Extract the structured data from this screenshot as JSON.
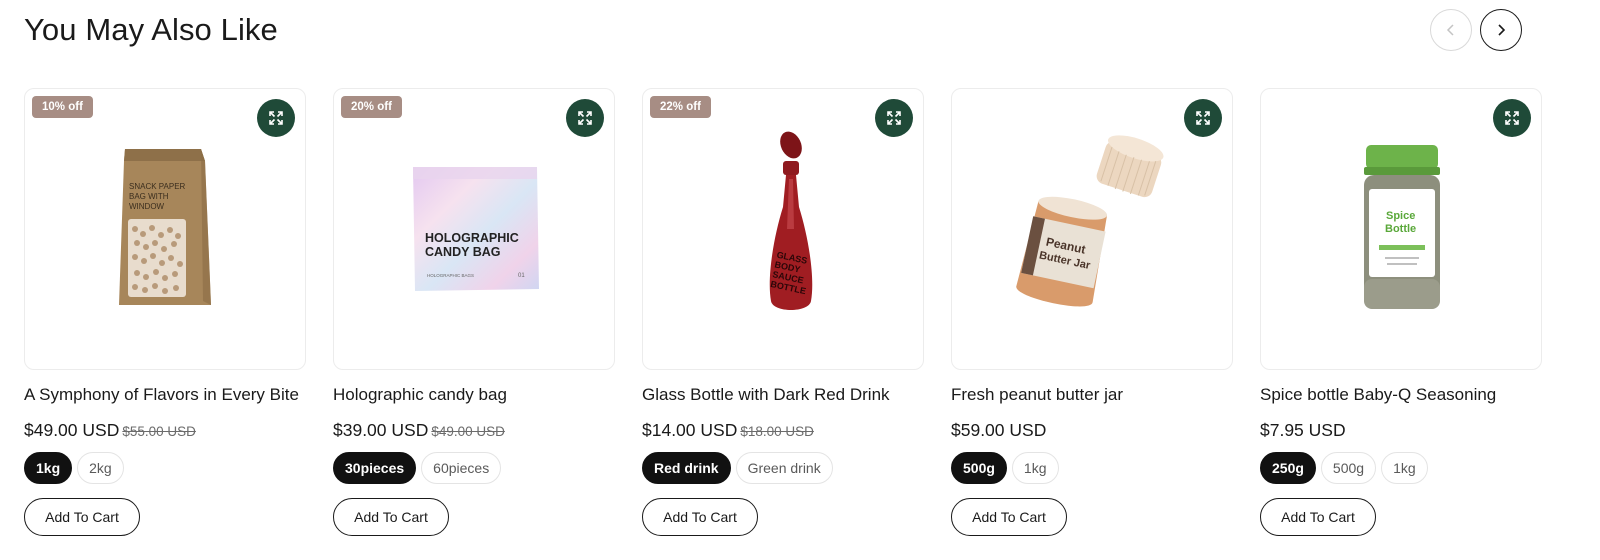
{
  "section": {
    "title": "You May Also Like"
  },
  "nav": {
    "prev_icon": "chevron-left-icon",
    "next_icon": "chevron-right-icon"
  },
  "colors": {
    "badge": "#a78d84",
    "expand_button": "#1f4a38",
    "chip_active": "#111111"
  },
  "products": [
    {
      "badge": "10% off",
      "title": "A Symphony of Flavors in Every Bite",
      "price": "$49.00 USD",
      "compare_price": "$55.00 USD",
      "variants": [
        "1kg",
        "2kg"
      ],
      "selected_variant": 0,
      "cart_label": "Add To Cart",
      "image_text": [
        "SNACK PAPER",
        "BAG WITH",
        "WINDOW"
      ]
    },
    {
      "badge": "20% off",
      "title": "Holographic candy bag",
      "price": "$39.00 USD",
      "compare_price": "$49.00 USD",
      "variants": [
        "30pieces",
        "60pieces"
      ],
      "selected_variant": 0,
      "cart_label": "Add To Cart",
      "image_text": [
        "HOLOGRAPHIC",
        "CANDY BAG",
        "HOLOGRAPHIC BAGS",
        "01"
      ]
    },
    {
      "badge": "22% off",
      "title": "Glass Bottle with Dark Red Drink",
      "price": "$14.00 USD",
      "compare_price": "$18.00 USD",
      "variants": [
        "Red drink",
        "Green drink"
      ],
      "selected_variant": 0,
      "cart_label": "Add To Cart",
      "image_text": [
        "GLASS",
        "BODY",
        "SAUCE",
        "BOTTLE"
      ]
    },
    {
      "badge": "",
      "title": "Fresh peanut butter jar",
      "price": "$59.00 USD",
      "compare_price": "",
      "variants": [
        "500g",
        "1kg"
      ],
      "selected_variant": 0,
      "cart_label": "Add To Cart",
      "image_text": [
        "Peanut",
        "Butter Jar"
      ]
    },
    {
      "badge": "",
      "title": "Spice bottle Baby-Q Seasoning",
      "price": "$7.95 USD",
      "compare_price": "",
      "variants": [
        "250g",
        "500g",
        "1kg"
      ],
      "selected_variant": 0,
      "cart_label": "Add To Cart",
      "image_text": [
        "Spice",
        "Bottle"
      ]
    }
  ]
}
